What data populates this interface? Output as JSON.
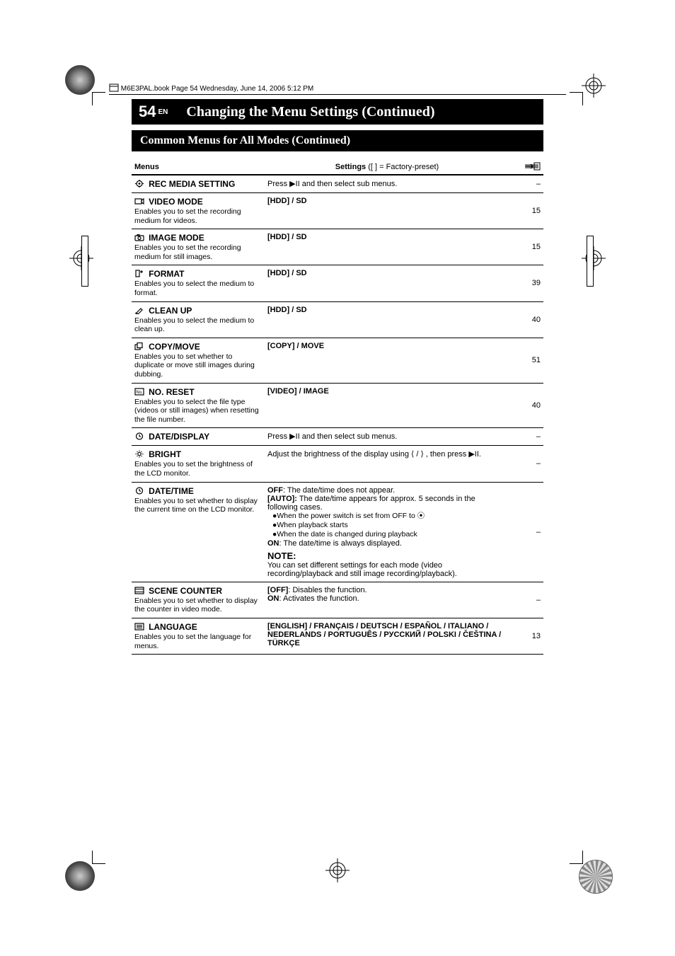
{
  "header_line": "M6E3PAL.book  Page 54  Wednesday, June 14, 2006  5:12 PM",
  "page_number": "54",
  "page_lang": "EN",
  "page_title": "Changing the Menu Settings (Continued)",
  "section_title": "Common Menus for All Modes (Continued)",
  "table": {
    "head_menus": "Menus",
    "head_settings_prefix": "Settings",
    "head_settings_hint": "([  ] = Factory-preset)",
    "rows": [
      {
        "icon": "gear-icon",
        "title": "REC MEDIA SETTING",
        "desc": "",
        "settings": "Press ▶II and then select sub menus.",
        "ref": "–"
      },
      {
        "icon": "video-mode-icon",
        "title": "VIDEO MODE",
        "desc": "Enables you to set the recording medium for videos.",
        "settings": "[HDD] / SD",
        "ref": "15"
      },
      {
        "icon": "image-mode-icon",
        "title": "IMAGE MODE",
        "desc": "Enables you to set the recording medium for still images.",
        "settings": "[HDD] / SD",
        "ref": "15"
      },
      {
        "icon": "format-icon",
        "title": "FORMAT",
        "desc": "Enables you to select the medium to format.",
        "settings": "[HDD] / SD",
        "ref": "39"
      },
      {
        "icon": "cleanup-icon",
        "title": "CLEAN UP",
        "desc": "Enables you to select the medium to clean up.",
        "settings": "[HDD] / SD",
        "ref": "40"
      },
      {
        "icon": "copy-move-icon",
        "title": "COPY/MOVE",
        "desc": "Enables you to set whether to duplicate or move still images during dubbing.",
        "settings": "[COPY] / MOVE",
        "ref": "51"
      },
      {
        "icon": "no-reset-icon",
        "title": "NO. RESET",
        "desc": "Enables you to select the file type (videos or still images) when resetting the file number.",
        "settings": "[VIDEO] / IMAGE",
        "ref": "40"
      },
      {
        "icon": "date-display-icon",
        "title": "DATE/DISPLAY",
        "desc": "",
        "settings": "Press ▶II and then select sub menus.",
        "ref": "–"
      },
      {
        "icon": "bright-icon",
        "title": "BRIGHT",
        "desc": "Enables you to set the brightness of the LCD monitor.",
        "settings": "Adjust the brightness of the display using  ⟨ / ⟩ , then press ▶II.",
        "ref": "–"
      },
      {
        "icon": "date-time-icon",
        "title": "DATE/TIME",
        "desc": "Enables you to set whether to display the current time on the LCD monitor.",
        "off": "OFF: The date/time does not appear.",
        "auto_label": "[AUTO]:",
        "auto_text": " The date/time appears for approx. 5 seconds in the following cases.",
        "bullets": [
          "●When the power switch is set from OFF to ⦿",
          "●When playback starts",
          "●When the date is changed during playback"
        ],
        "on": "ON: The date/time is always displayed.",
        "note_label": "NOTE:",
        "note_text": "You can set different settings for each mode (video recording/playback and still image recording/playback).",
        "ref": "–"
      },
      {
        "icon": "scene-counter-icon",
        "title": "SCENE COUNTER",
        "desc": "Enables you to set whether to display the counter in video mode.",
        "off": "[OFF]: Disables the function.",
        "on": "ON: Activates the function.",
        "ref": "–"
      },
      {
        "icon": "language-icon",
        "title": "LANGUAGE",
        "desc": "Enables you to set the language for menus.",
        "settings": "[ENGLISH] / FRANÇAIS / DEUTSCH / ESPAÑOL / ITALIANO / NEDERLANDS / PORTUGUÊS / РУССКИЙ / POLSKI / ČEŠTINA / TÜRKÇE",
        "ref": "13"
      }
    ]
  },
  "chart_data": null
}
